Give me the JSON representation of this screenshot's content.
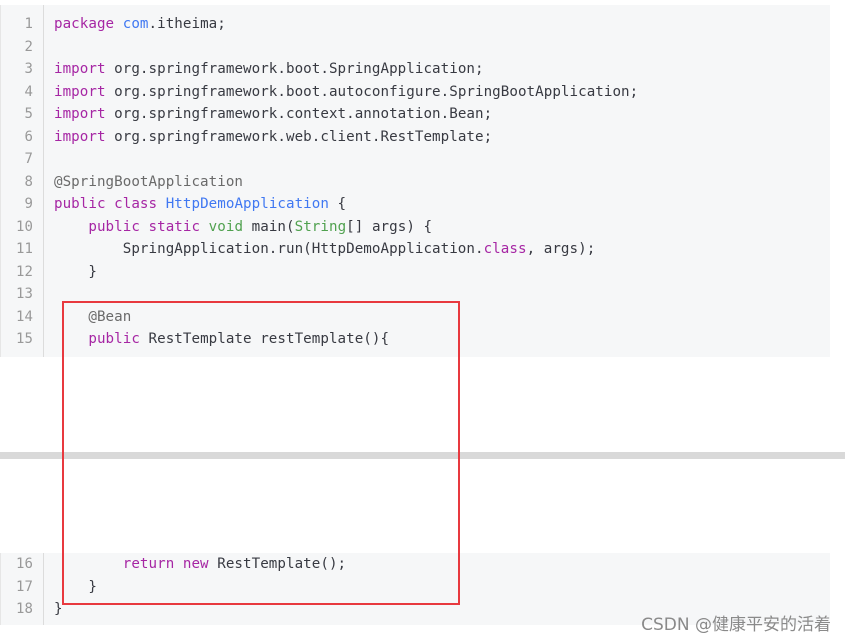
{
  "code": {
    "lines_top": [
      {
        "n": "1",
        "tokens": [
          {
            "t": "package ",
            "c": "kw"
          },
          {
            "t": "com",
            "c": "cls"
          },
          {
            "t": ".itheima;",
            "c": ""
          }
        ]
      },
      {
        "n": "2",
        "tokens": []
      },
      {
        "n": "3",
        "tokens": [
          {
            "t": "import ",
            "c": "kw"
          },
          {
            "t": "org.springframework.boot.SpringApplication;",
            "c": ""
          }
        ]
      },
      {
        "n": "4",
        "tokens": [
          {
            "t": "import ",
            "c": "kw"
          },
          {
            "t": "org.springframework.boot.autoconfigure.SpringBootApplication;",
            "c": ""
          }
        ]
      },
      {
        "n": "5",
        "tokens": [
          {
            "t": "import ",
            "c": "kw"
          },
          {
            "t": "org.springframework.context.annotation.Bean;",
            "c": ""
          }
        ]
      },
      {
        "n": "6",
        "tokens": [
          {
            "t": "import ",
            "c": "kw"
          },
          {
            "t": "org.springframework.web.client.RestTemplate;",
            "c": ""
          }
        ]
      },
      {
        "n": "7",
        "tokens": []
      },
      {
        "n": "8",
        "tokens": [
          {
            "t": "@SpringBootApplication",
            "c": "an"
          }
        ]
      },
      {
        "n": "9",
        "tokens": [
          {
            "t": "public ",
            "c": "kw"
          },
          {
            "t": "class ",
            "c": "kw"
          },
          {
            "t": "HttpDemoApplication",
            "c": "cls"
          },
          {
            "t": " {",
            "c": ""
          }
        ]
      },
      {
        "n": "10",
        "tokens": [
          {
            "t": "    public ",
            "c": "kw"
          },
          {
            "t": "static ",
            "c": "kw"
          },
          {
            "t": "void ",
            "c": "ty"
          },
          {
            "t": "main(",
            "c": ""
          },
          {
            "t": "String",
            "c": "ty"
          },
          {
            "t": "[] args) {",
            "c": ""
          }
        ]
      },
      {
        "n": "11",
        "tokens": [
          {
            "t": "        SpringApplication.run(HttpDemoApplication.",
            "c": ""
          },
          {
            "t": "class",
            "c": "kw"
          },
          {
            "t": ", args);",
            "c": ""
          }
        ]
      },
      {
        "n": "12",
        "tokens": [
          {
            "t": "    }",
            "c": ""
          }
        ]
      },
      {
        "n": "13",
        "tokens": []
      },
      {
        "n": "14",
        "tokens": [
          {
            "t": "    @Bean",
            "c": "an"
          }
        ]
      },
      {
        "n": "15",
        "tokens": [
          {
            "t": "    public ",
            "c": "kw"
          },
          {
            "t": "RestTemplate restTemplate(){",
            "c": ""
          }
        ]
      }
    ],
    "lines_bottom": [
      {
        "n": "16",
        "tokens": [
          {
            "t": "        return ",
            "c": "kw"
          },
          {
            "t": "new ",
            "c": "kw"
          },
          {
            "t": "RestTemplate();",
            "c": ""
          }
        ]
      },
      {
        "n": "17",
        "tokens": [
          {
            "t": "    }",
            "c": ""
          }
        ]
      },
      {
        "n": "18",
        "tokens": [
          {
            "t": "}",
            "c": ""
          }
        ]
      }
    ]
  },
  "watermark": "CSDN @健康平安的活着",
  "colors": {
    "highlight_border": "#e8393f",
    "keyword": "#a626a4",
    "class_name": "#4078f2",
    "type": "#50a14f"
  }
}
